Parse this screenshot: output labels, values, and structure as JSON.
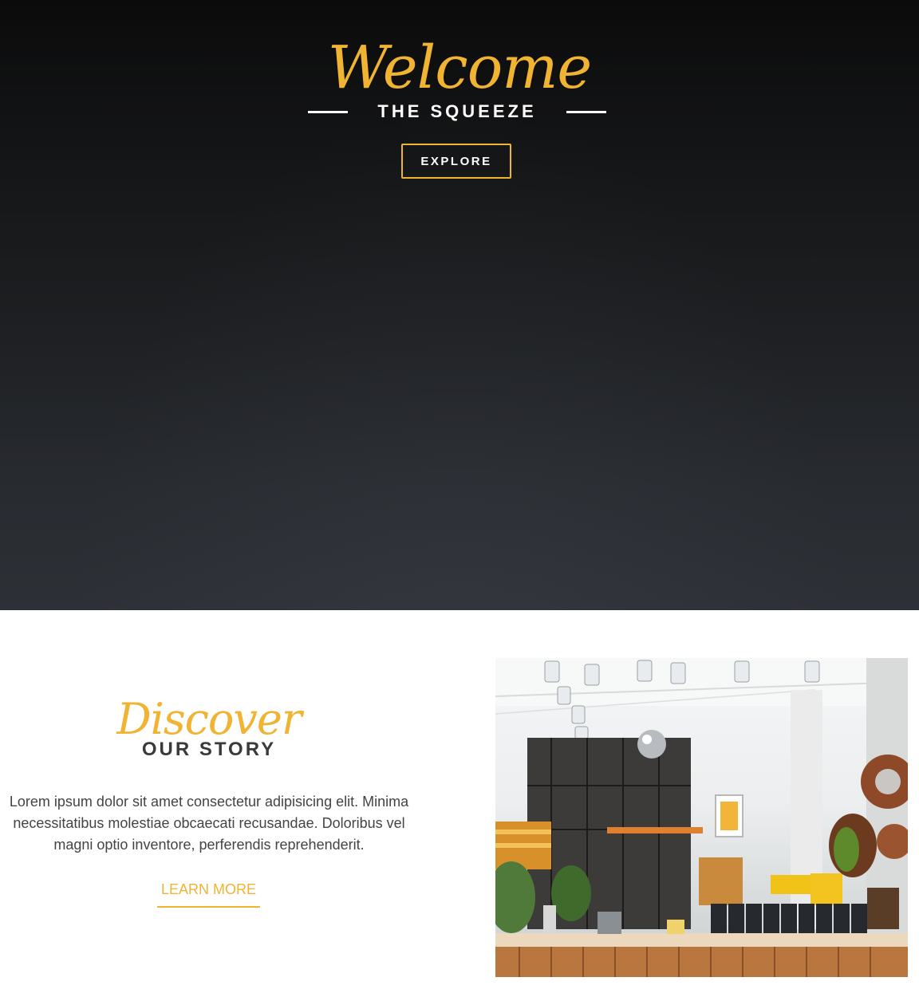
{
  "hero": {
    "welcome": "Welcome",
    "subtitle": "THE SQUEEZE",
    "explore_label": "EXPLORE"
  },
  "story": {
    "script_title": "Discover",
    "title": "OUR STORY",
    "body": "Lorem ipsum dolor sit amet consectetur adipisicing elit. Minima necessitatibus molestiae obcaecati recusandae. Doloribus vel magni optio inventore, perferendis reprehenderit.",
    "learn_more_label": "LEARN MORE"
  },
  "colors": {
    "accent": "#f0b332",
    "hero_bg_top": "#0b0b0c",
    "hero_bg_bottom": "#2d3036",
    "heading_dark": "#3a3a3a",
    "body_text": "#444444"
  }
}
